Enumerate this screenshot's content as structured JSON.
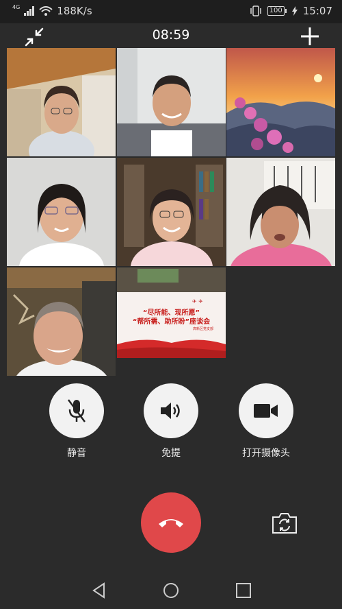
{
  "status_bar": {
    "network": "4G",
    "speed": "188K/s",
    "battery": "100",
    "time": "15:07"
  },
  "call": {
    "duration": "08:59"
  },
  "participants": [
    {
      "id": "p1",
      "desc": "participant-1"
    },
    {
      "id": "p2",
      "desc": "participant-2"
    },
    {
      "id": "p3",
      "desc": "participant-3-scenery"
    },
    {
      "id": "p4",
      "desc": "participant-4"
    },
    {
      "id": "p5",
      "desc": "participant-5"
    },
    {
      "id": "p6",
      "desc": "participant-6"
    },
    {
      "id": "p7",
      "desc": "participant-7"
    },
    {
      "id": "p8",
      "desc": "participant-8-tv-banner"
    }
  ],
  "banner": {
    "line1": "“尽所能、现所愿”",
    "line2": "“帮所需、助所盼”座谈会",
    "line3": "高新区党支部"
  },
  "controls": {
    "mute": "静音",
    "speaker": "免提",
    "camera": "打开摄像头"
  },
  "colors": {
    "background": "#2b2b2b",
    "hangup": "#e0484a",
    "control_bg": "#f2f2f2"
  }
}
